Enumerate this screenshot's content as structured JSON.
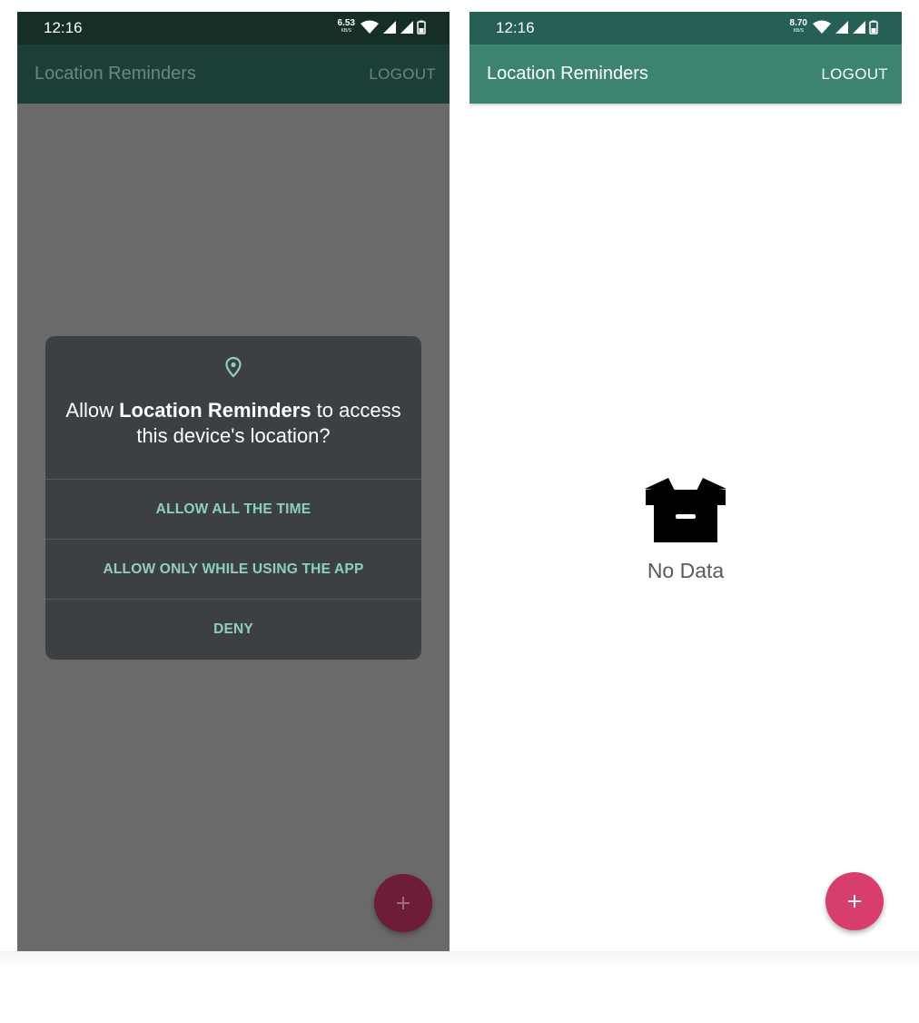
{
  "left_screen": {
    "status_bar": {
      "time": "12:16",
      "net_speed": "6.53",
      "net_unit": "KB/S"
    },
    "app_bar": {
      "title": "Location Reminders",
      "action": "LOGOUT"
    },
    "permission_dialog": {
      "icon": "location-pin-icon",
      "title_prefix": "Allow ",
      "title_app": "Location Reminders",
      "title_suffix": " to access this device's location?",
      "buttons": [
        "ALLOW ALL THE TIME",
        "ALLOW ONLY WHILE USING THE APP",
        "DENY"
      ]
    },
    "fab": {
      "icon": "plus-icon"
    }
  },
  "right_screen": {
    "status_bar": {
      "time": "12:16",
      "net_speed": "8.70",
      "net_unit": "KB/S"
    },
    "app_bar": {
      "title": "Location Reminders",
      "action": "LOGOUT"
    },
    "empty_state": {
      "icon": "open-box-icon",
      "text": "No Data"
    },
    "fab": {
      "icon": "plus-icon"
    }
  },
  "colors": {
    "app_bar": "#3c8372",
    "status_bar": "#265f53",
    "fab": "#d73e6b",
    "dialog_bg": "#3d4043",
    "dialog_button_text": "#8fcfc2",
    "scrim": "#6a6a6a"
  }
}
